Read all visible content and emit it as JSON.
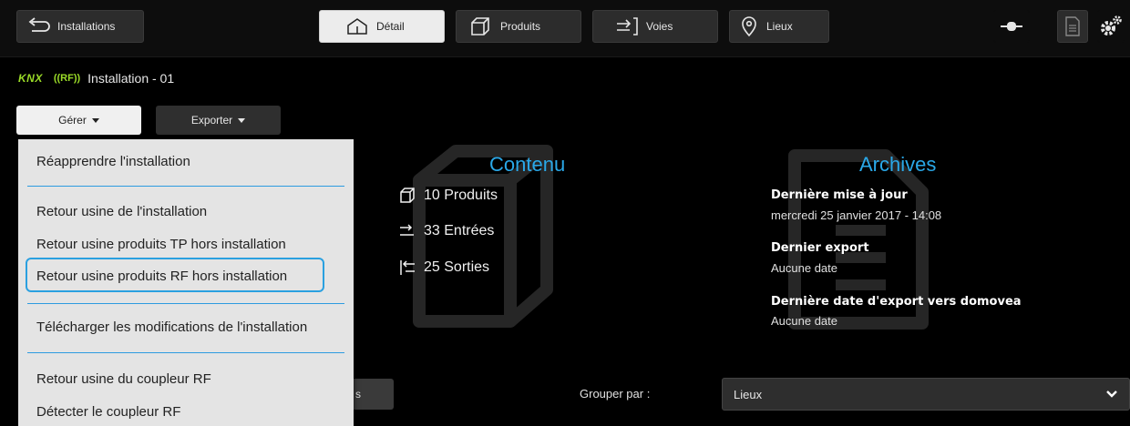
{
  "topbar": {
    "back_label": "Installations",
    "tabs": [
      {
        "label": "Détail",
        "active": true
      },
      {
        "label": "Produits",
        "active": false
      },
      {
        "label": "Voies",
        "active": false
      },
      {
        "label": "Lieux",
        "active": false
      }
    ]
  },
  "installation": {
    "knx_badge": "KNX",
    "rf_badge": "((RF))",
    "name": "Installation - 01"
  },
  "actions": {
    "gerer_label": "Gérer",
    "exporter_label": "Exporter"
  },
  "gerer_menu": {
    "items": [
      "Réapprendre l'installation",
      "Retour usine de l'installation",
      "Retour usine produits TP hors installation",
      "Retour usine produits RF hors installation",
      "Télécharger les modifications de l'installation",
      "Retour usine du coupleur RF",
      "Détecter le coupleur RF"
    ],
    "highlighted_index": 3
  },
  "contenu": {
    "title": "Contenu",
    "produits": "10 Produits",
    "entrees": "33 Entrées",
    "sorties": "25 Sorties"
  },
  "archives": {
    "title": "Archives",
    "last_update_label": "Dernière mise à jour",
    "last_update_value": "mercredi 25 janvier 2017 - 14:08",
    "last_export_label": "Dernier export",
    "last_export_value": "Aucune date",
    "domovea_label": "Dernière date d'export vers domovea",
    "domovea_value": "Aucune date"
  },
  "grouping": {
    "stub_button_text": "s",
    "label": "Grouper par :",
    "selected": "Lieux"
  },
  "colors": {
    "accent_blue": "#2aa8e8",
    "knx_green": "#9bdc28",
    "background": "#000000"
  }
}
